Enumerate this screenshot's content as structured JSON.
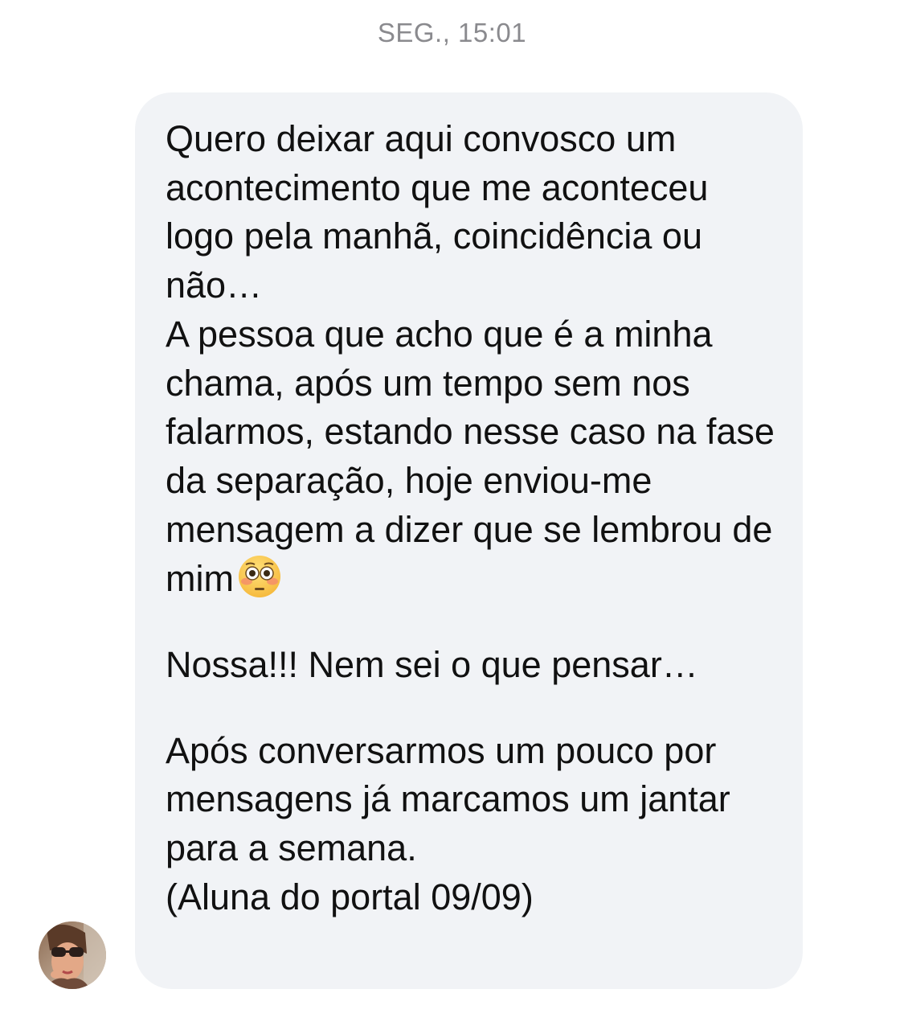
{
  "timestamp": "SEG., 15:01",
  "message": {
    "paragraph1": "Quero deixar aqui convosco um acontecimento que me aconteceu logo pela manhã, coincidência ou não…",
    "paragraph2": "A pessoa que acho que é a minha chama, após um tempo sem nos falarmos, estando nesse caso na fase da separação, hoje enviou-me mensagem a dizer que se lembrou de mim",
    "paragraph2_emoji": "flushed-face-emoji",
    "paragraph3": "Nossa!!! Nem sei o que pensar…",
    "paragraph4": "Após conversarmos um pouco por mensagens já marcamos um jantar para a semana.",
    "paragraph5": "(Aluna do portal 09/09)"
  },
  "sender": {
    "avatar_icon": "user-avatar"
  },
  "colors": {
    "bubble_background": "#f1f3f6",
    "timestamp_text": "#8a8a8e",
    "message_text": "#111111"
  }
}
